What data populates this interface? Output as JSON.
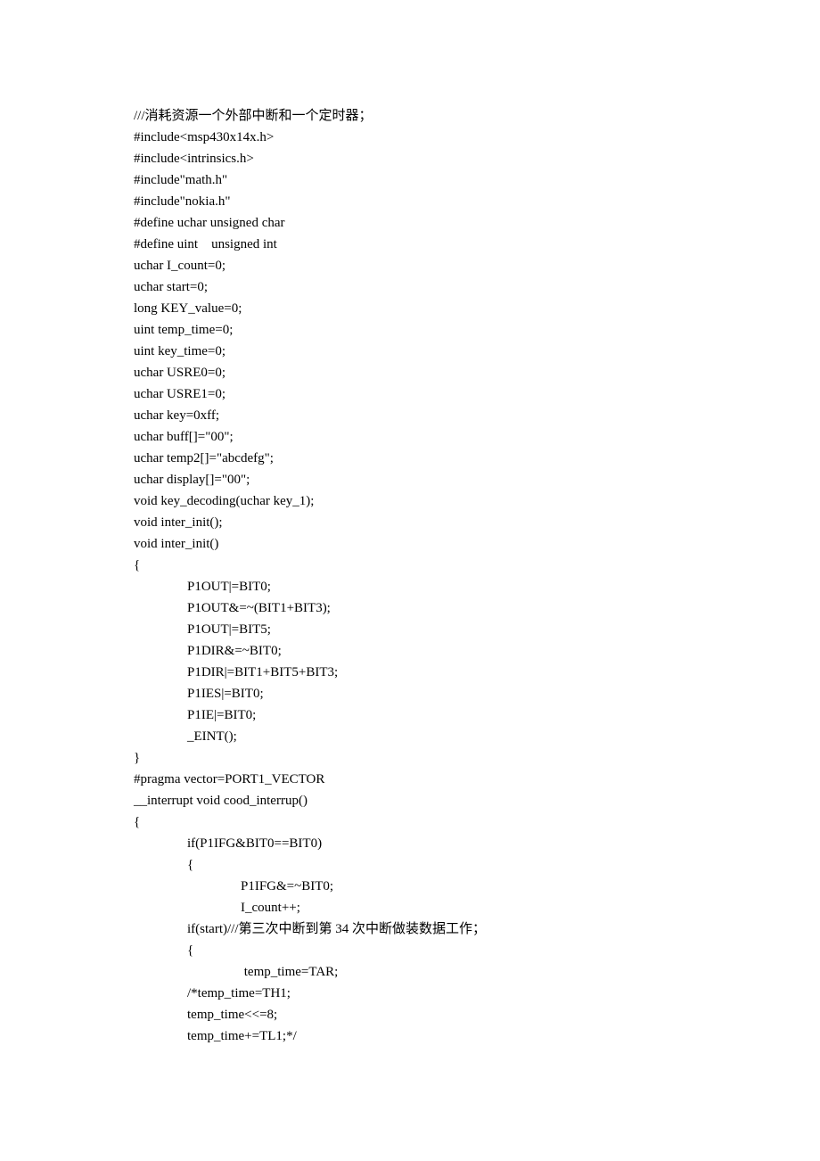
{
  "lines": [
    {
      "text": "///消耗资源一个外部中断和一个定时器；",
      "indent": 0
    },
    {
      "text": "#include<msp430x14x.h>",
      "indent": 0
    },
    {
      "text": "#include<intrinsics.h>",
      "indent": 0
    },
    {
      "text": "#include\"math.h\"",
      "indent": 0
    },
    {
      "text": "#include\"nokia.h\"",
      "indent": 0
    },
    {
      "text": "#define uchar unsigned char",
      "indent": 0
    },
    {
      "text": "#define uint    unsigned int",
      "indent": 0
    },
    {
      "text": "uchar I_count=0;",
      "indent": 0
    },
    {
      "text": "uchar start=0;",
      "indent": 0
    },
    {
      "text": "long KEY_value=0;",
      "indent": 0
    },
    {
      "text": "uint temp_time=0;",
      "indent": 0
    },
    {
      "text": "uint key_time=0;",
      "indent": 0
    },
    {
      "text": "uchar USRE0=0;",
      "indent": 0
    },
    {
      "text": "uchar USRE1=0;",
      "indent": 0
    },
    {
      "text": "uchar key=0xff;",
      "indent": 0
    },
    {
      "text": "uchar buff[]=\"00\";",
      "indent": 0
    },
    {
      "text": "uchar temp2[]=\"abcdefg\";",
      "indent": 0
    },
    {
      "text": "uchar display[]=\"00\";",
      "indent": 0
    },
    {
      "text": "void key_decoding(uchar key_1);",
      "indent": 0
    },
    {
      "text": "void inter_init();",
      "indent": 0
    },
    {
      "text": "void inter_init()",
      "indent": 0
    },
    {
      "text": "{",
      "indent": 0
    },
    {
      "text": "P1OUT|=BIT0;",
      "indent": 1
    },
    {
      "text": "P1OUT&=~(BIT1+BIT3);",
      "indent": 1
    },
    {
      "text": "P1OUT|=BIT5;",
      "indent": 1
    },
    {
      "text": "P1DIR&=~BIT0;",
      "indent": 1
    },
    {
      "text": "P1DIR|=BIT1+BIT5+BIT3;",
      "indent": 1
    },
    {
      "text": "P1IES|=BIT0;",
      "indent": 1
    },
    {
      "text": "P1IE|=BIT0;",
      "indent": 1
    },
    {
      "text": "_EINT();",
      "indent": 1
    },
    {
      "text": "}",
      "indent": 0
    },
    {
      "text": "#pragma vector=PORT1_VECTOR",
      "indent": 0
    },
    {
      "text": "__interrupt void cood_interrup()",
      "indent": 0
    },
    {
      "text": "{",
      "indent": 0
    },
    {
      "text": "if(P1IFG&BIT0==BIT0)",
      "indent": 1
    },
    {
      "text": "{",
      "indent": 1
    },
    {
      "text": "P1IFG&=~BIT0;",
      "indent": 2
    },
    {
      "text": "I_count++;",
      "indent": 2
    },
    {
      "text": "if(start)///第三次中断到第 34 次中断做装数据工作；",
      "indent": 1
    },
    {
      "text": "{",
      "indent": 1
    },
    {
      "text": " temp_time=TAR;",
      "indent": 2
    },
    {
      "text": "/*temp_time=TH1;",
      "indent": 1
    },
    {
      "text": "temp_time<<=8;",
      "indent": 1
    },
    {
      "text": "temp_time+=TL1;*/",
      "indent": 1
    }
  ]
}
